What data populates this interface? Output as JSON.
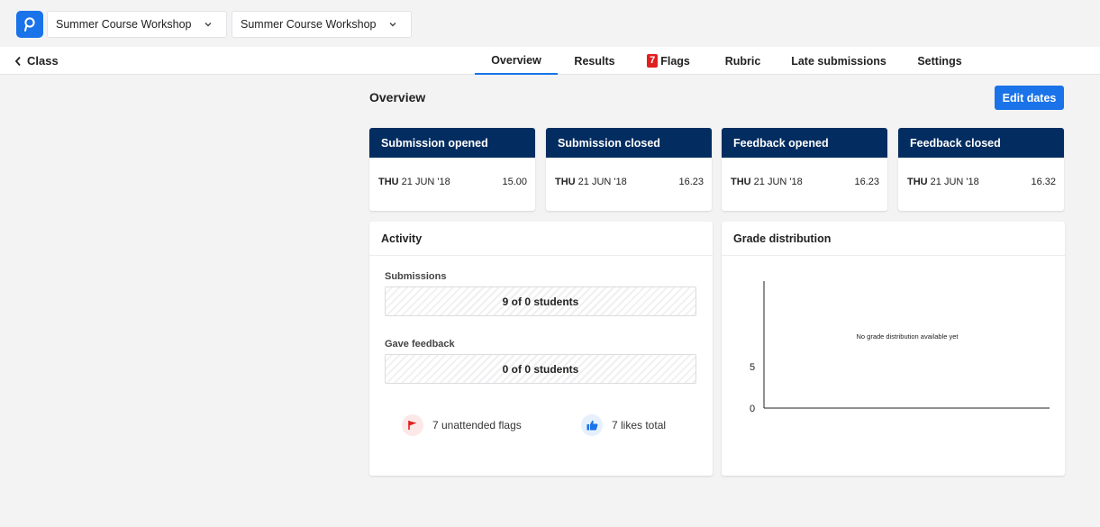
{
  "topbar": {
    "logo_glyph": "P",
    "select1": "Summer Course Workshop",
    "select2": "Summer Course Workshop"
  },
  "nav": {
    "back_label": "Class",
    "tabs": [
      {
        "label": "Overview"
      },
      {
        "label": "Results"
      },
      {
        "label": "Flags",
        "badge": "7"
      },
      {
        "label": "Rubric"
      },
      {
        "label": "Late submissions"
      },
      {
        "label": "Settings"
      }
    ]
  },
  "overview": {
    "title": "Overview",
    "edit_button": "Edit dates"
  },
  "date_cards": [
    {
      "title": "Submission opened",
      "day": "THU",
      "date": "21 JUN '18",
      "time": "15.00"
    },
    {
      "title": "Submission closed",
      "day": "THU",
      "date": "21 JUN '18",
      "time": "16.23"
    },
    {
      "title": "Feedback opened",
      "day": "THU",
      "date": "21 JUN '18",
      "time": "16.23"
    },
    {
      "title": "Feedback closed",
      "day": "THU",
      "date": "21 JUN '18",
      "time": "16.32"
    }
  ],
  "activity": {
    "title": "Activity",
    "submissions_label": "Submissions",
    "submissions_value": "9 of 0 students",
    "feedback_label": "Gave feedback",
    "feedback_value": "0 of 0 students",
    "flags_stat": "7 unattended flags",
    "likes_stat": "7 likes total"
  },
  "grade": {
    "title": "Grade distribution",
    "empty_message": "No grade distribution available yet",
    "y_ticks": [
      "5",
      "0"
    ]
  },
  "colors": {
    "accent": "#1a73e8",
    "card_header": "#032d60",
    "flag_red": "#e0201f"
  }
}
